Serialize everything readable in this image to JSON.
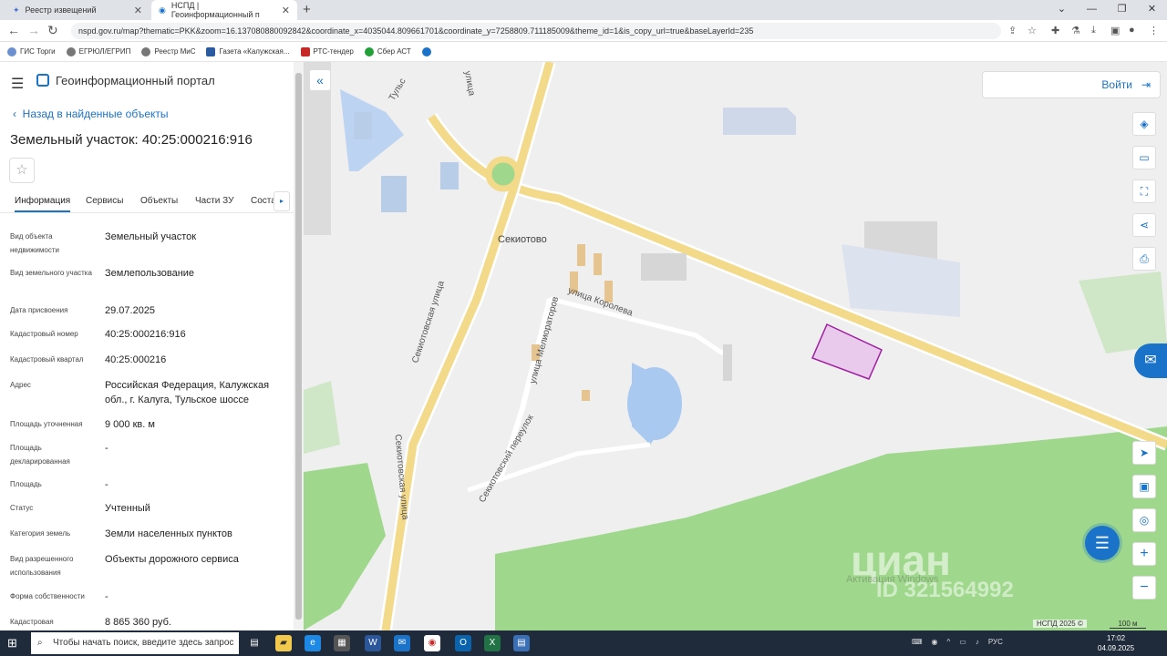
{
  "browser": {
    "tabs": [
      {
        "title": "Реестр извещений"
      },
      {
        "title": "НСПД | Геоинформационный п"
      }
    ],
    "url": "nspd.gov.ru/map?thematic=PKK&zoom=16.137080880092842&coordinate_x=4035044.809661701&coordinate_y=7258809.711185009&theme_id=1&is_copy_url=true&baseLayerId=235",
    "bookmarks": [
      "ГИС Торги",
      "ЕГРЮЛ/ЕГРИП",
      "Реестр МиС",
      "Газета «Калужская...",
      "РТС-тендер",
      "Сбер АСТ"
    ]
  },
  "app": {
    "title": "Геоинформационный портал",
    "back_label": "Назад в найденные объекты",
    "object_title": "Земельный участок: 40:25:000216:916",
    "tabs": [
      "Информация",
      "Сервисы",
      "Объекты",
      "Части ЗУ",
      "Соста"
    ],
    "fields": [
      {
        "label": "Вид объекта недвижимости",
        "value": "Земельный участок"
      },
      {
        "label": "Вид земельного участка",
        "value": "Землепользование"
      },
      {
        "label": "Дата присвоения",
        "value": "29.07.2025"
      },
      {
        "label": "Кадастровый номер",
        "value": "40:25:000216:916"
      },
      {
        "label": "Кадастровый квартал",
        "value": "40:25:000216"
      },
      {
        "label": "Адрес",
        "value": "Российская Федерация, Калужская обл., г. Калуга, Тульское шоссе"
      },
      {
        "label": "Площадь уточненная",
        "value": "9 000 кв. м"
      },
      {
        "label": "Площадь декларированная",
        "value": "-"
      },
      {
        "label": "Площадь",
        "value": "-"
      },
      {
        "label": "Статус",
        "value": "Учтенный"
      },
      {
        "label": "Категория земель",
        "value": "Земли населенных пунктов"
      },
      {
        "label": "Вид разрешенного использования",
        "value": "Объекты дорожного сервиса"
      },
      {
        "label": "Форма собственности",
        "value": "-"
      },
      {
        "label": "Кадастровая",
        "value": "8 865 360 руб."
      }
    ]
  },
  "map": {
    "login_label": "Войти",
    "labels": {
      "village": "Секиотово",
      "street_korolev": "улица Королева",
      "street_sekiotovskaya": "Секиотовская улица",
      "street_sekiotovskaya2": "Секиотовская улица",
      "street_meliorators": "улица Мелиораторов",
      "lane": "Секиотовский переулок",
      "tulskoe": "Тульс",
      "ulitsa": "улица"
    },
    "copyright": "НСПД 2025 ©",
    "scale": "100 м",
    "watermark": "циан",
    "watermark_id": "ID 321564992",
    "activation": "Активация Windows"
  },
  "taskbar": {
    "search_placeholder": "Чтобы начать поиск, введите здесь запрос",
    "lang": "РУС",
    "time": "17:02",
    "date": "04.09.2025"
  }
}
